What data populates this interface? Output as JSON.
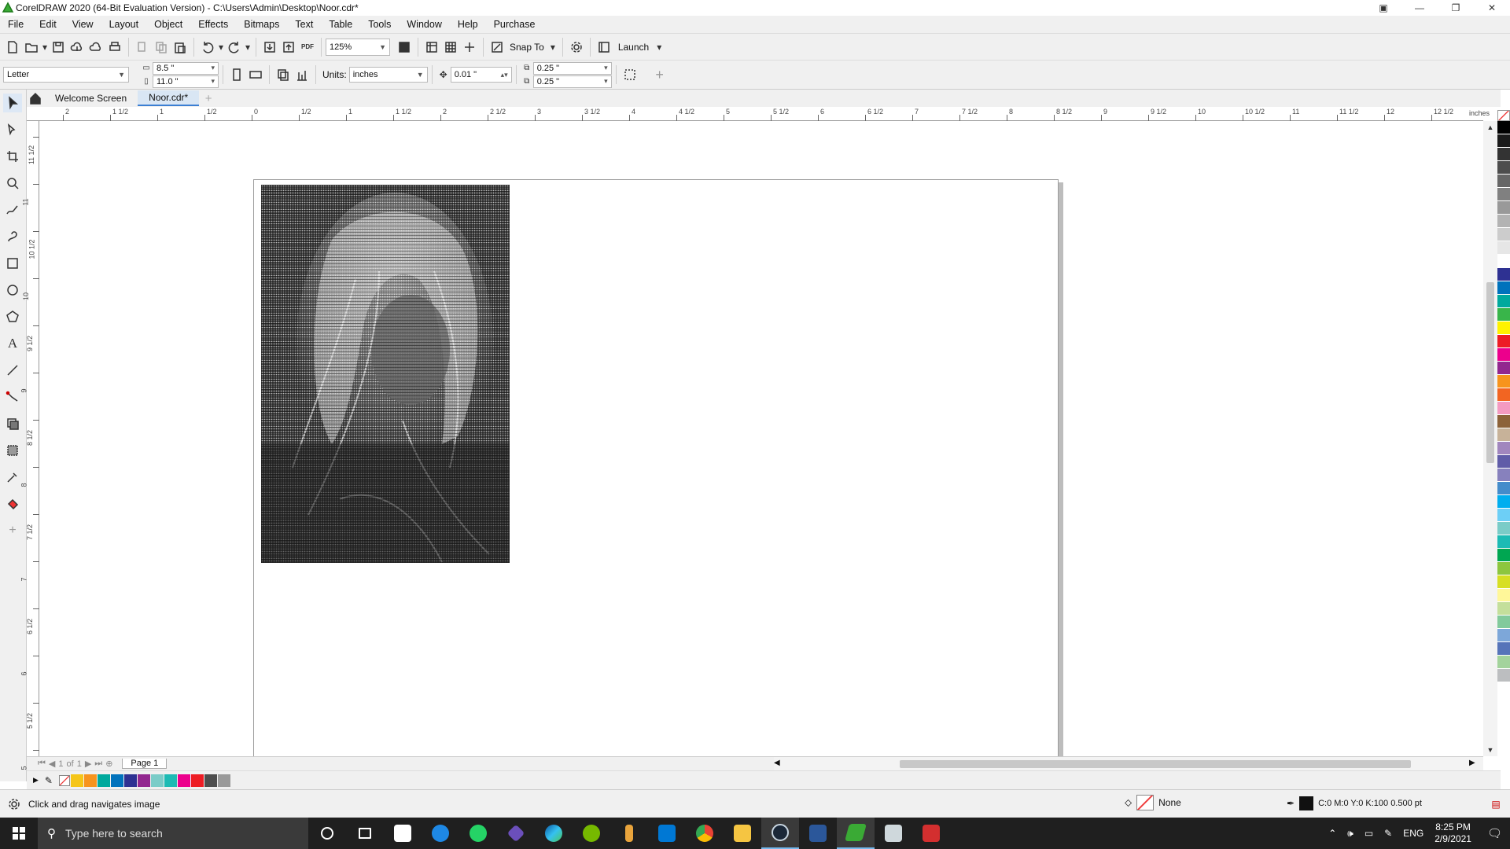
{
  "app": {
    "title": "CorelDRAW 2020 (64-Bit Evaluation Version) - C:\\Users\\Admin\\Desktop\\Noor.cdr*"
  },
  "menu": [
    "File",
    "Edit",
    "View",
    "Layout",
    "Object",
    "Effects",
    "Bitmaps",
    "Text",
    "Table",
    "Tools",
    "Window",
    "Help",
    "Purchase"
  ],
  "toolbar": {
    "zoom": "125%",
    "snap_label": "Snap To",
    "launch_label": "Launch",
    "pdf_label": "PDF"
  },
  "property_bar": {
    "page_size": "Letter",
    "width": "8.5 \"",
    "height": "11.0 \"",
    "units_label": "Units:",
    "units": "inches",
    "nudge": "0.01 \"",
    "dup_x": "0.25 \"",
    "dup_y": "0.25 \""
  },
  "tabs": [
    {
      "label": "Welcome Screen"
    },
    {
      "label": "Noor.cdr*"
    }
  ],
  "ruler": {
    "unit": "inches",
    "h_ticks": [
      "2",
      "1 1/2",
      "1",
      "1/2",
      "0",
      "1/2",
      "1",
      "1 1/2",
      "2",
      "2 1/2",
      "3",
      "3 1/2",
      "4",
      "4 1/2",
      "5",
      "5 1/2",
      "6",
      "6 1/2",
      "7",
      "7 1/2",
      "8",
      "8 1/2",
      "9",
      "9 1/2",
      "10",
      "10 1/2",
      "11",
      "11 1/2",
      "12",
      "12 1/2"
    ],
    "v_ticks": [
      "11 1/2",
      "11",
      "10 1/2",
      "10",
      "9 1/2",
      "9",
      "8 1/2",
      "8",
      "7 1/2",
      "7",
      "6 1/2",
      "6",
      "5 1/2",
      "5"
    ]
  },
  "pagenav": {
    "pos": "1",
    "of": "of",
    "total": "1",
    "page_tab": "Page 1"
  },
  "palette": {
    "colors": [
      "#000000",
      "#1a1a1a",
      "#333333",
      "#4d4d4d",
      "#666666",
      "#808080",
      "#999999",
      "#b3b3b3",
      "#cccccc",
      "#e6e6e6",
      "#ffffff",
      "#2e3192",
      "#0072bc",
      "#00a99d",
      "#39b54a",
      "#fff200",
      "#ed1c24",
      "#ec008c",
      "#92278f",
      "#f7941d",
      "#f26522",
      "#f49ac1",
      "#8c6239",
      "#c7b299",
      "#a186be",
      "#605ca8",
      "#8781bd",
      "#448ccb",
      "#00aeef",
      "#6dcff6",
      "#7accc8",
      "#1cbbb4",
      "#00a651",
      "#8dc63f",
      "#d7df23",
      "#fff799",
      "#c4df9b",
      "#82ca9c",
      "#7da7d9",
      "#5674b9",
      "#a3d39c",
      "#bcbec0"
    ]
  },
  "doc_palette": {
    "colors": [
      "#f5c518",
      "#f7941d",
      "#00a99d",
      "#0072bc",
      "#2e3192",
      "#92278f",
      "#7accc8",
      "#1cbbb4",
      "#ec008c",
      "#ed1c24",
      "#4d4d4d",
      "#999999"
    ]
  },
  "status": {
    "message": "Click and drag navigates image",
    "fill": "None",
    "outline": "C:0 M:0 Y:0 K:100  0.500 pt"
  },
  "taskbar": {
    "search_placeholder": "Type here to search",
    "time": "8:25 PM",
    "date": "2/9/2021",
    "lang": "ENG"
  }
}
